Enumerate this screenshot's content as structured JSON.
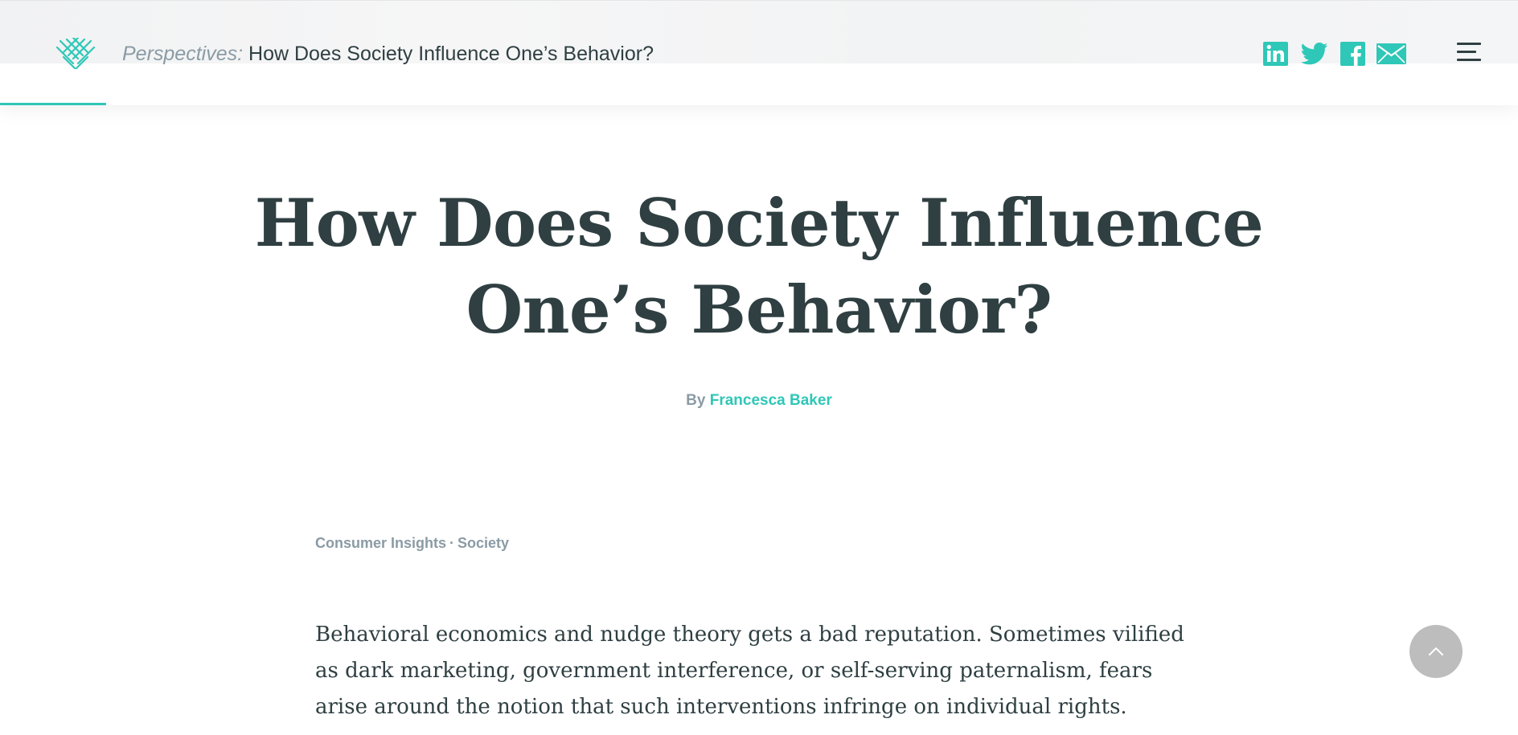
{
  "header": {
    "breadcrumb_section": "Perspectives:",
    "breadcrumb_title": "How Does Society Influence One’s Behavior?",
    "reading_progress_percent": 7,
    "social": [
      {
        "name": "linkedin-icon",
        "label": "LinkedIn"
      },
      {
        "name": "twitter-icon",
        "label": "Twitter"
      },
      {
        "name": "facebook-icon",
        "label": "Facebook"
      },
      {
        "name": "email-icon",
        "label": "Email"
      }
    ],
    "menu_icon": "hamburger-menu-icon"
  },
  "article": {
    "title": "How Does Society Influence One’s Behavior?",
    "byline_prefix": "By",
    "author": "Francesca Baker",
    "tags": [
      "Consumer Insights",
      "Society"
    ],
    "tag_separator": "·",
    "lead": "Behavioral economics and nudge theory gets a bad reputation. Sometimes vilified as dark marketing, government interference, or self-serving paternalism, fears arise around the notion that such interventions infringe on individual rights."
  },
  "controls": {
    "back_to_top_icon": "chevron-up-icon"
  },
  "colors": {
    "accent": "#2fc7b7",
    "text": "#2f3f42",
    "muted": "#8a9ba5",
    "back_to_top_bg": "#bdbdbd"
  }
}
